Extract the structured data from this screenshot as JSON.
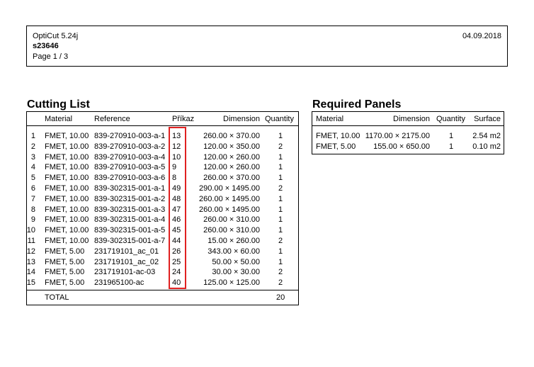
{
  "header": {
    "app": "OptiCut 5.24j",
    "project": "s23646",
    "page": "Page 1 / 3",
    "date": "04.09.2018"
  },
  "cutting_list": {
    "title": "Cutting List",
    "columns": [
      "Material",
      "Reference",
      "Příkaz",
      "Dimension",
      "Quantity"
    ],
    "rows": [
      [
        "1",
        "FMET, 10.00",
        "839-270910-003-a-1",
        "13",
        "260.00 × 370.00",
        "1"
      ],
      [
        "2",
        "FMET, 10.00",
        "839-270910-003-a-2",
        "12",
        "120.00 × 350.00",
        "2"
      ],
      [
        "3",
        "FMET, 10.00",
        "839-270910-003-a-4",
        "10",
        "120.00 × 260.00",
        "1"
      ],
      [
        "4",
        "FMET, 10.00",
        "839-270910-003-a-5",
        "9",
        "120.00 × 260.00",
        "1"
      ],
      [
        "5",
        "FMET, 10.00",
        "839-270910-003-a-6",
        "8",
        "260.00 × 370.00",
        "1"
      ],
      [
        "6",
        "FMET, 10.00",
        "839-302315-001-a-1",
        "49",
        "290.00 × 1495.00",
        "2"
      ],
      [
        "7",
        "FMET, 10.00",
        "839-302315-001-a-2",
        "48",
        "260.00 × 1495.00",
        "1"
      ],
      [
        "8",
        "FMET, 10.00",
        "839-302315-001-a-3",
        "47",
        "260.00 × 1495.00",
        "1"
      ],
      [
        "9",
        "FMET, 10.00",
        "839-302315-001-a-4",
        "46",
        "260.00 × 310.00",
        "1"
      ],
      [
        "10",
        "FMET, 10.00",
        "839-302315-001-a-5",
        "45",
        "260.00 × 310.00",
        "1"
      ],
      [
        "11",
        "FMET, 10.00",
        "839-302315-001-a-7",
        "44",
        "15.00 × 260.00",
        "2"
      ],
      [
        "12",
        "FMET, 5.00",
        "231719101_ac_01",
        "26",
        "343.00 × 60.00",
        "1"
      ],
      [
        "13",
        "FMET, 5.00",
        "231719101_ac_02",
        "25",
        "50.00 × 50.00",
        "1"
      ],
      [
        "14",
        "FMET, 5.00",
        "231719101-ac-03",
        "24",
        "30.00 × 30.00",
        "2"
      ],
      [
        "15",
        "FMET, 5.00",
        "231965100-ac",
        "40",
        "125.00 × 125.00",
        "2"
      ]
    ],
    "total_label": "TOTAL",
    "total_quantity": "20"
  },
  "required_panels": {
    "title": "Required Panels",
    "columns": [
      "Material",
      "Dimension",
      "Quantity",
      "Surface"
    ],
    "rows": [
      [
        "FMET, 10.00",
        "1170.00 × 2175.00",
        "1",
        "2.54 m2"
      ],
      [
        "FMET, 5.00",
        "155.00 × 650.00",
        "1",
        "0.10 m2"
      ]
    ]
  },
  "highlight_color": "#e02020"
}
